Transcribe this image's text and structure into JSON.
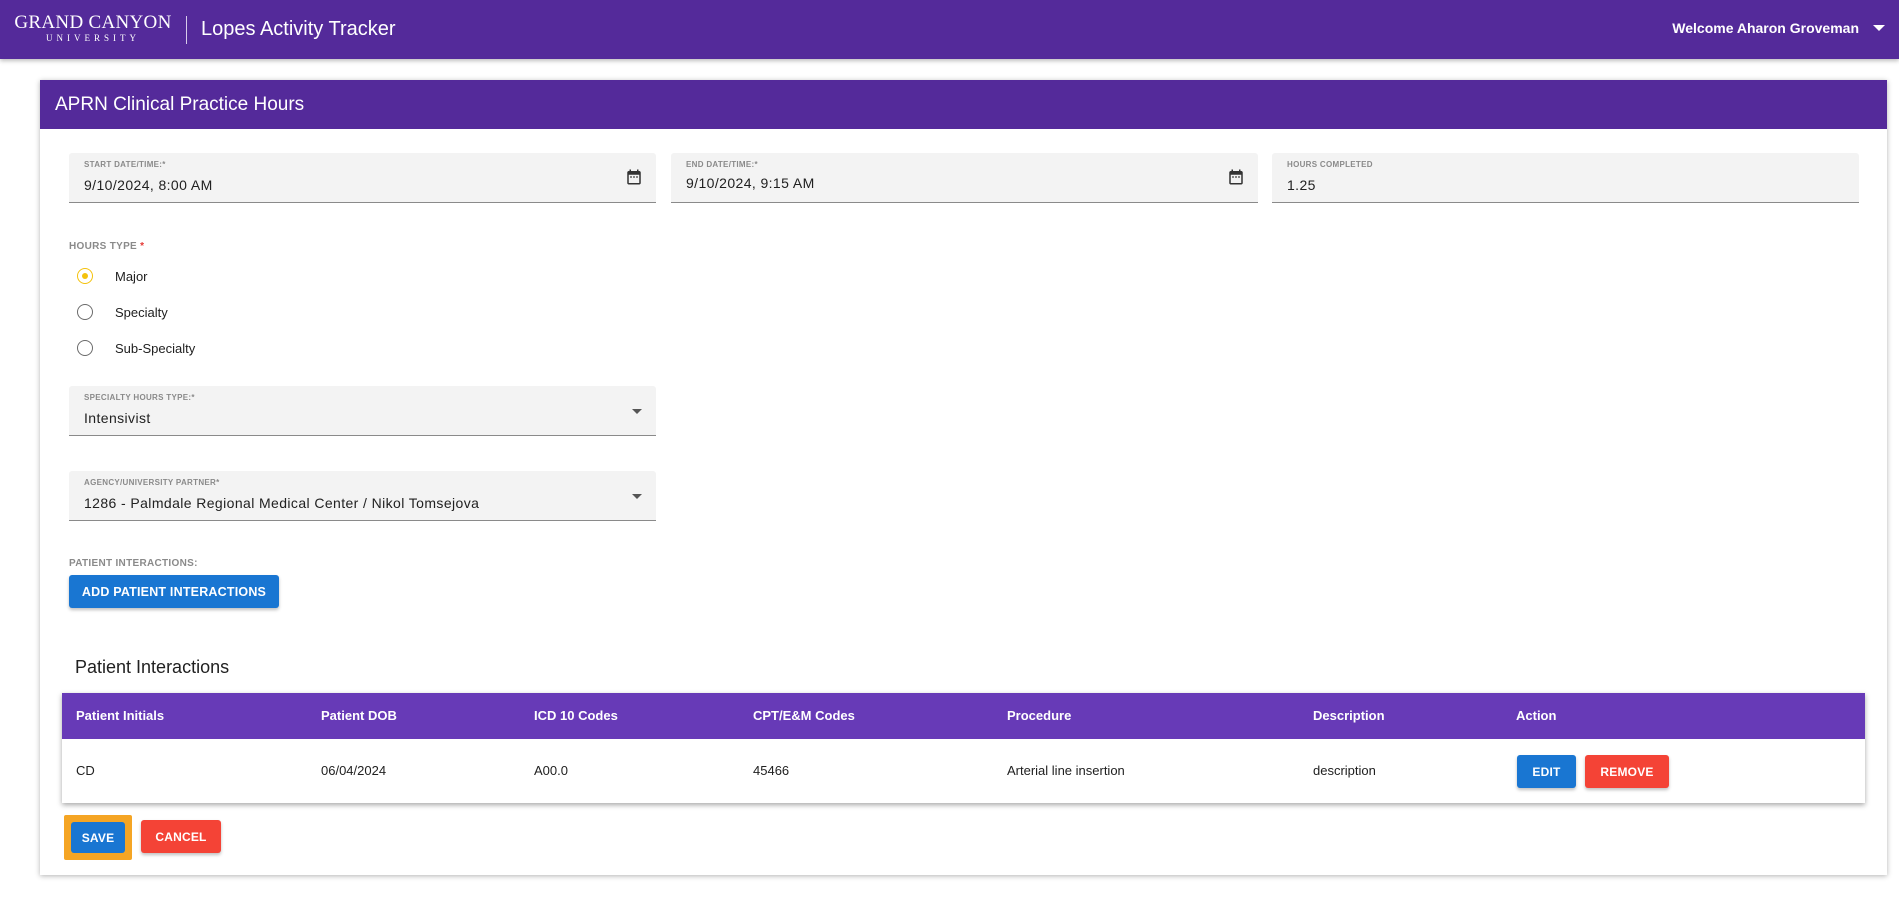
{
  "header": {
    "logo_main": "GRAND CANYON",
    "logo_sub": "UNIVERSITY",
    "app_title": "Lopes Activity Tracker",
    "welcome": "Welcome Aharon Groveman"
  },
  "card": {
    "title": "APRN Clinical Practice Hours"
  },
  "form": {
    "start": {
      "label": "START DATE/TIME:",
      "required": "*",
      "value": "9/10/2024, 8:00 AM"
    },
    "end": {
      "label": "END DATE/TIME:",
      "required": "*",
      "value": "9/10/2024, 9:15 AM"
    },
    "hours": {
      "label": "HOURS COMPLETED",
      "value": "1.25"
    },
    "hours_type": {
      "label": "HOURS TYPE",
      "required": "*",
      "options": [
        "Major",
        "Specialty",
        "Sub-Specialty"
      ],
      "selected": "Major"
    },
    "specialty": {
      "label": "SPECIALTY HOURS TYPE:",
      "required": "*",
      "value": "Intensivist"
    },
    "agency": {
      "label": "AGENCY/UNIVERSITY PARTNER",
      "required": "*",
      "value": "1286 - Palmdale Regional Medical Center / Nikol Tomsejova"
    },
    "patient_interactions_label": "PATIENT INTERACTIONS:",
    "add_button": "ADD PATIENT INTERACTIONS"
  },
  "interactions": {
    "heading": "Patient Interactions",
    "columns": [
      "Patient Initials",
      "Patient DOB",
      "ICD 10 Codes",
      "CPT/E&M Codes",
      "Procedure",
      "Description",
      "Action"
    ],
    "rows": [
      {
        "initials": "CD",
        "dob": "06/04/2024",
        "icd": "A00.0",
        "cpt": "45466",
        "procedure": "Arterial line insertion",
        "description": "description",
        "edit": "EDIT",
        "remove": "REMOVE"
      }
    ]
  },
  "actions": {
    "save": "SAVE",
    "cancel": "CANCEL"
  },
  "colors": {
    "primary_purple": "#542a9a",
    "table_header": "#673ab7",
    "button_blue": "#1976d2",
    "button_red": "#f44336",
    "radio_selected": "#f4c20d",
    "focus_highlight": "#f5a524"
  },
  "icons": {
    "calendar": "calendar-icon",
    "dropdown": "chevron-down-icon",
    "user_menu": "caret-down-icon"
  }
}
